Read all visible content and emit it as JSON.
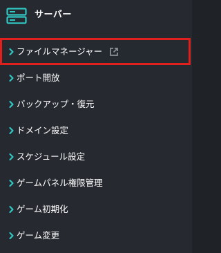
{
  "header": {
    "title": "サーバー",
    "icon": "server-icon",
    "accent_color": "#31c7c3"
  },
  "menu": {
    "chevron_icon": "chevron-right-icon",
    "chevron_color": "#31c7c3",
    "highlight_color": "#e0201c",
    "items": [
      {
        "label": "ファイルマネージャー",
        "external_icon": "external-link-icon"
      },
      {
        "label": "ポート開放"
      },
      {
        "label": "バックアップ・復元"
      },
      {
        "label": "ドメイン設定"
      },
      {
        "label": "スケジュール設定"
      },
      {
        "label": "ゲームパネル権限管理"
      },
      {
        "label": "ゲーム初期化"
      },
      {
        "label": "ゲーム変更"
      }
    ]
  }
}
